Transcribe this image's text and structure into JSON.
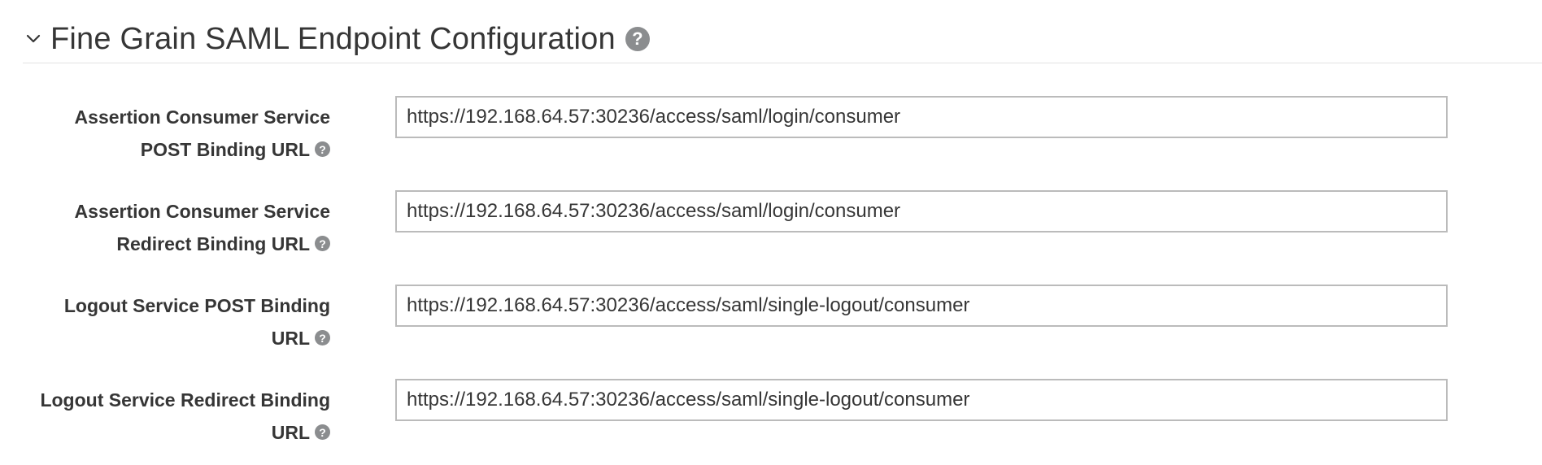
{
  "section": {
    "title": "Fine Grain SAML Endpoint Configuration",
    "chevron_icon": "chevron-down-icon",
    "help_icon": "question-circle-icon"
  },
  "fields": [
    {
      "label_line1": "Assertion Consumer Service",
      "label_line2": "POST Binding URL",
      "value": "https://192.168.64.57:30236/access/saml/login/consumer"
    },
    {
      "label_line1": "Assertion Consumer Service",
      "label_line2": "Redirect Binding URL",
      "value": "https://192.168.64.57:30236/access/saml/login/consumer"
    },
    {
      "label_line1": "Logout Service POST Binding",
      "label_line2": "URL",
      "value": "https://192.168.64.57:30236/access/saml/single-logout/consumer"
    },
    {
      "label_line1": "Logout Service Redirect Binding",
      "label_line2": "URL",
      "value": "https://192.168.64.57:30236/access/saml/single-logout/consumer"
    }
  ],
  "colors": {
    "text": "#363636",
    "border": "#bbbbbb",
    "help_icon": "#8b8d8f",
    "divider": "#e2e2e2"
  }
}
